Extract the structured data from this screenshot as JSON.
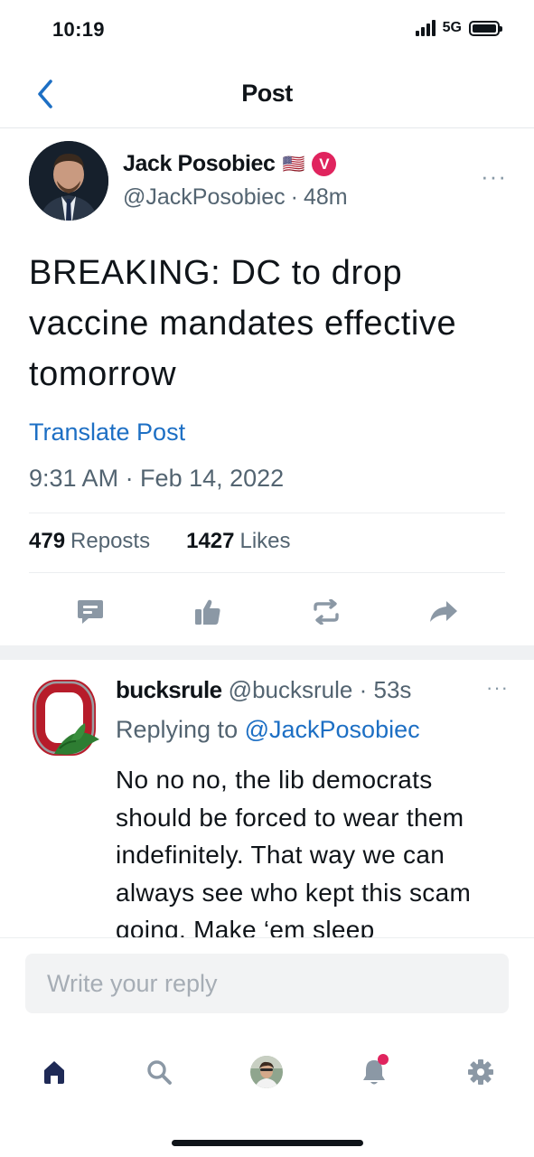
{
  "status_bar": {
    "time": "10:19",
    "network": "5G"
  },
  "nav": {
    "title": "Post"
  },
  "post": {
    "author_name": "Jack Posobiec",
    "flag": "🇺🇸",
    "verified_letter": "V",
    "handle": "@JackPosobiec",
    "age": "48m",
    "separator": "·",
    "more": "···",
    "text": "BREAKING: DC to drop vaccine mandates effective tomorrow",
    "translate_label": "Translate Post",
    "timestamp": "9:31 AM · Feb 14, 2022",
    "reposts_count": "479",
    "reposts_label": "Reposts",
    "likes_count": "1427",
    "likes_label": "Likes",
    "actions": [
      "comment-icon",
      "like-icon",
      "repost-icon",
      "share-icon"
    ]
  },
  "reply": {
    "name": "bucksrule",
    "handle": "@bucksrule",
    "separator": "·",
    "age": "53s",
    "more": "···",
    "replying_prefix": "Replying to",
    "replying_to": "@JackPosobiec",
    "text": "No no no, the lib democrats should be forced to wear them indefinitely. That way we can always see who kept this scam going. Make ‘em sleep"
  },
  "compose": {
    "placeholder": "Write your reply"
  },
  "tab_bar": {
    "items": [
      "home-icon",
      "search-icon",
      "profile-avatar",
      "notifications-icon",
      "settings-icon"
    ],
    "active": "home-icon"
  },
  "colors": {
    "accent": "#1d6fc4",
    "text": "#0f1419",
    "muted": "#536471",
    "icon": "#8b98a5",
    "verified": "#e0245e",
    "tab_active": "#1f2a56"
  }
}
